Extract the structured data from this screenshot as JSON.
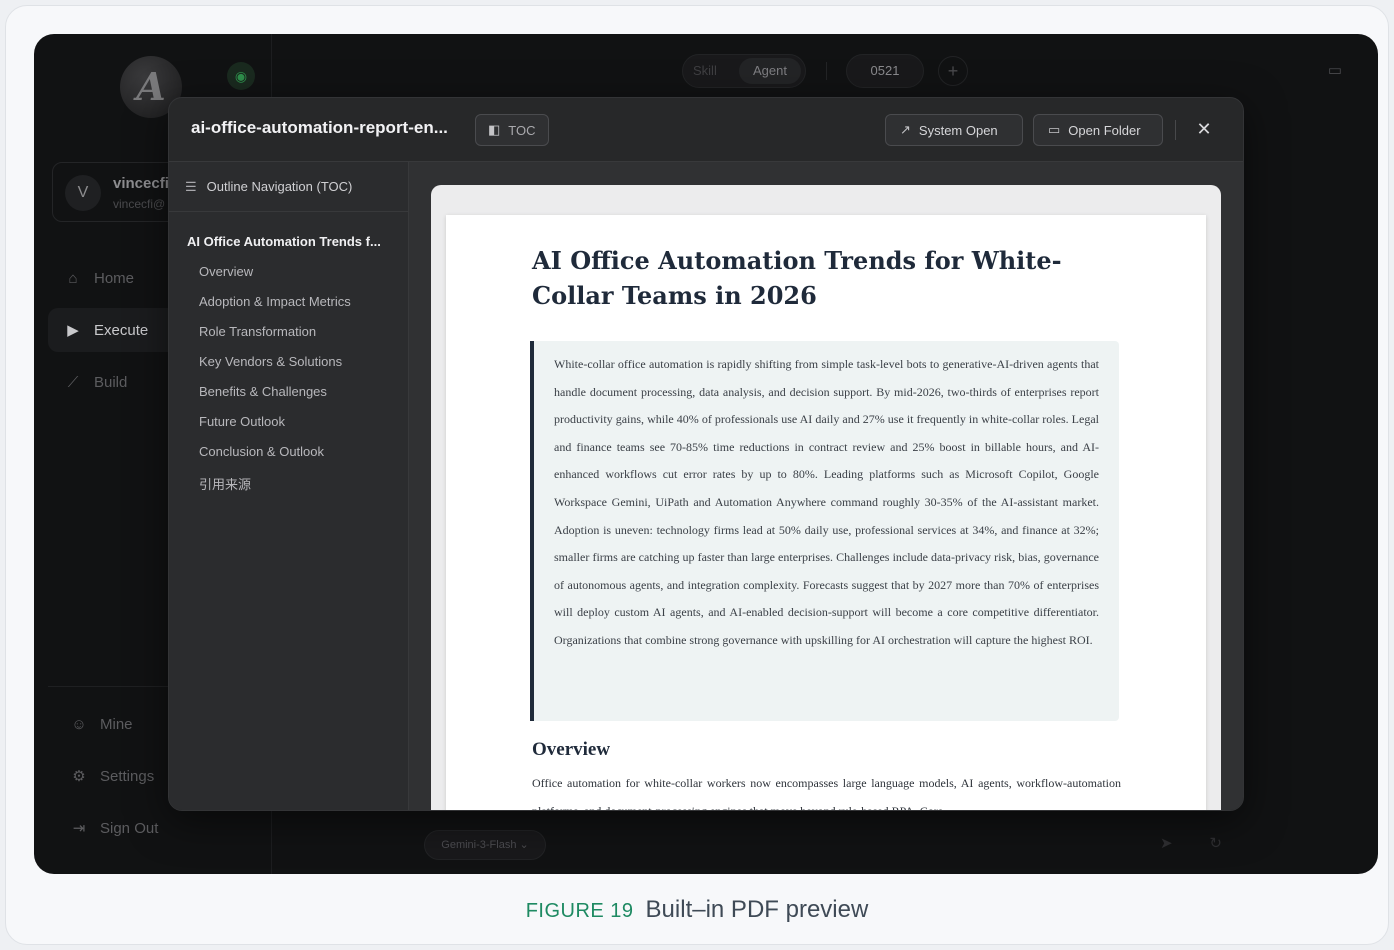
{
  "app": {
    "logo_letter": "A",
    "user": {
      "initial": "V",
      "name": "vincecfi",
      "email": "vincecfi@"
    },
    "nav": [
      {
        "label": "Home",
        "icon": "home-icon"
      },
      {
        "label": "Execute",
        "icon": "play-icon"
      },
      {
        "label": "Build",
        "icon": "magic-wand-icon"
      }
    ],
    "bottom_nav": [
      {
        "label": "Mine",
        "icon": "user-icon"
      },
      {
        "label": "Settings",
        "icon": "gear-icon"
      },
      {
        "label": "Sign Out",
        "icon": "sign-out-icon"
      }
    ],
    "topbar": {
      "seg_skill": "Skill",
      "seg_agent": "Agent",
      "tab": "0521"
    },
    "model": "Gemini-3-Flash ⌄"
  },
  "modal": {
    "title": "ai-office-automation-report-en...",
    "toc_button": "TOC",
    "system_open": "System Open",
    "open_folder": "Open Folder",
    "toc_heading": "Outline Navigation (TOC)",
    "toc_main": "AI Office Automation Trends f...",
    "toc_items": [
      "Overview",
      "Adoption & Impact Metrics",
      "Role Transformation",
      "Key Vendors & Solutions",
      "Benefits & Challenges",
      "Future Outlook",
      "Conclusion & Outlook",
      "引用来源"
    ]
  },
  "document": {
    "title": "AI Office Automation Trends for White-Collar Teams in 2026",
    "summary": "White-collar office automation is rapidly shifting from simple task-level bots to generative-AI-driven agents that handle document processing, data analysis, and decision support. By mid-2026, two-thirds of enterprises report productivity gains, while 40% of professionals use AI daily and 27% use it frequently in white-collar roles. Legal and finance teams see 70-85% time reductions in contract review and 25% boost in billable hours, and AI-enhanced workflows cut error rates by up to 80%. Leading platforms such as Microsoft Copilot, Google Workspace Gemini, UiPath and Automation Anywhere command roughly 30-35% of the AI-assistant market. Adoption is uneven: technology firms lead at 50% daily use, professional services at 34%, and finance at 32%; smaller firms are catching up faster than large enterprises. Challenges include data-privacy risk, bias, governance of autonomous agents, and integration complexity. Forecasts suggest that by 2027 more than 70% of enterprises will deploy custom AI agents, and AI-enabled decision-support will become a core competitive differentiator. Organizations that combine strong governance with upskilling for AI orchestration will capture the highest ROI.",
    "overview_heading": "Overview",
    "overview_text": "Office automation for white-collar workers now encompasses large language models, AI agents, workflow-automation platforms, and document-processing engines that move beyond rule-based RPA. Core"
  },
  "caption": {
    "figure": "FIGURE 19",
    "text": "Built–in PDF preview"
  }
}
